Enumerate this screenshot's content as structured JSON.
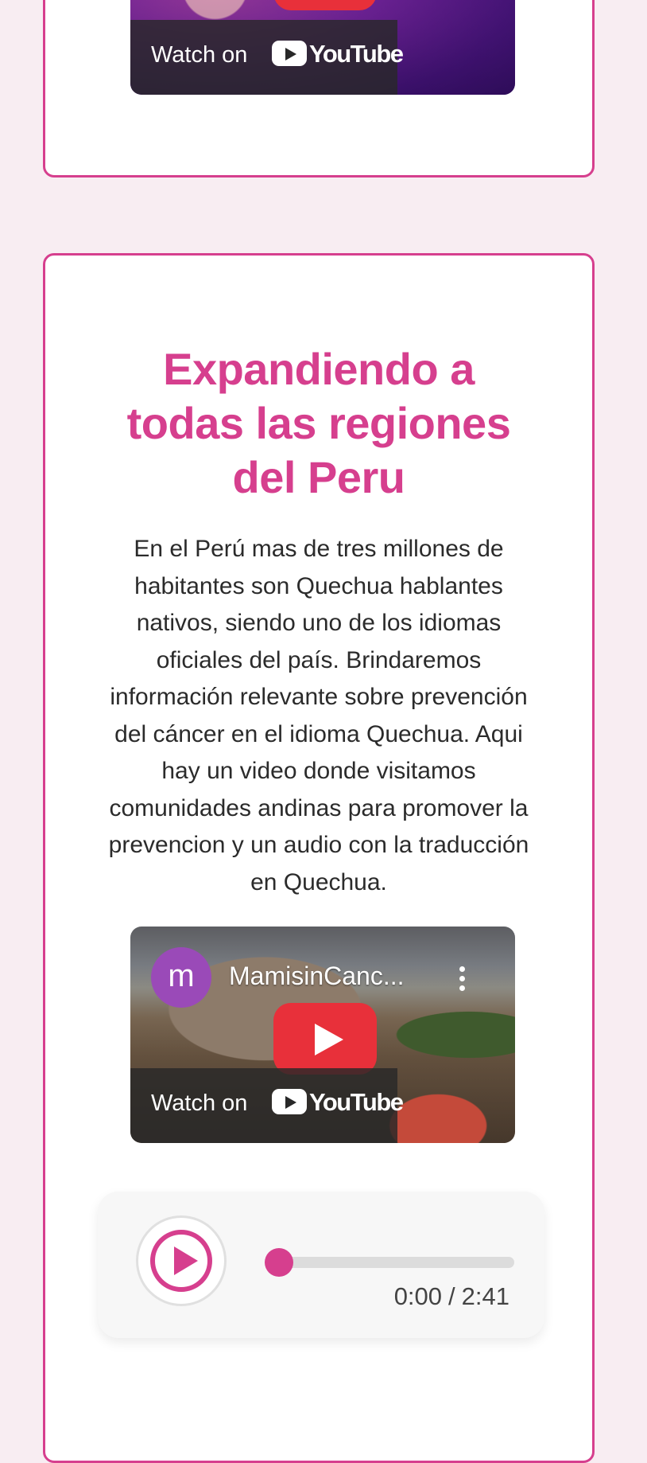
{
  "top_card": {
    "video": {
      "watch_on": "Watch on",
      "youtube_word": "YouTube"
    }
  },
  "main_card": {
    "heading": "Expandiendo a todas las regiones del Peru",
    "body": "En el Perú mas de tres millones de habitantes son Quechua hablantes nativos, siendo uno de los idiomas oficiales del país. Brindaremos información relevante sobre prevención del cáncer en el idioma Quechua. Aqui hay un video donde visitamos comunidades andinas para promover la prevencion y un audio con la traducción en Quechua.",
    "video": {
      "channel_initial": "m",
      "channel_title": "MamisinCanc...",
      "watch_on": "Watch on",
      "youtube_word": "YouTube"
    },
    "audio": {
      "current_time": "0:00",
      "separator": "/",
      "duration": "2:41",
      "progress": 0
    }
  },
  "colors": {
    "accent": "#d63f8e",
    "page_background": "#f8edf2",
    "youtube_red": "#e8303a"
  },
  "icons": {
    "video_play": "youtube-play-icon",
    "audio_play": "play-circle-icon",
    "more": "kebab-menu-icon"
  }
}
